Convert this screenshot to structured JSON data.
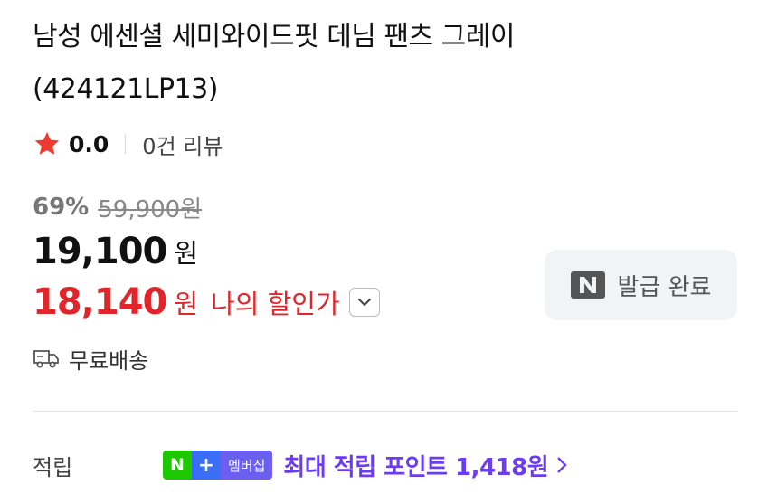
{
  "product": {
    "title_line1": "남성 에센셜 세미와이드핏 데님 팬츠 그레이",
    "title_line2": "(424121LP13)"
  },
  "rating": {
    "score": "0.0",
    "review_text": "0건 리뷰",
    "star_color": "#ee3b2f"
  },
  "price": {
    "discount_rate": "69%",
    "original_price": "59,900원",
    "sale_price": "19,100",
    "sale_unit": "원",
    "my_price": "18,140",
    "my_unit": "원",
    "my_label": "나의 할인가",
    "accent_color": "#e0262a"
  },
  "coupon": {
    "label": "발급 완료",
    "icon": "naver-n-icon"
  },
  "shipping": {
    "label": "무료배송",
    "icon": "truck-icon"
  },
  "points": {
    "label": "적립",
    "badge_n": "N",
    "badge_plus": "+",
    "badge_member": "멤버십",
    "text": "최대 적립 포인트 1,418원",
    "accent_color": "#6b3cf2"
  }
}
